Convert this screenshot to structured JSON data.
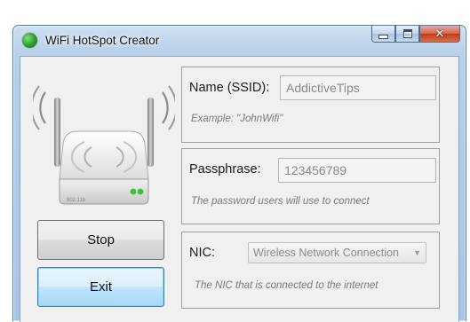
{
  "window": {
    "title": "WiFi HotSpot Creator"
  },
  "router": {
    "model_text": "802.11b"
  },
  "buttons": {
    "stop": "Stop",
    "exit": "Exit"
  },
  "ssid": {
    "label": "Name (SSID):",
    "value": "AddictiveTips",
    "hint": "Example: \"JohnWifi\""
  },
  "passphrase": {
    "label": "Passphrase:",
    "value": "123456789",
    "hint": "The password users will use to connect"
  },
  "nic": {
    "label": "NIC:",
    "selected": "Wireless Network Connection",
    "hint": "The NIC that is connected to the internet"
  },
  "colors": {
    "accent_green": "#2a9a2a",
    "close_red": "#c0391b",
    "focus_blue": "#3c7fb1"
  }
}
